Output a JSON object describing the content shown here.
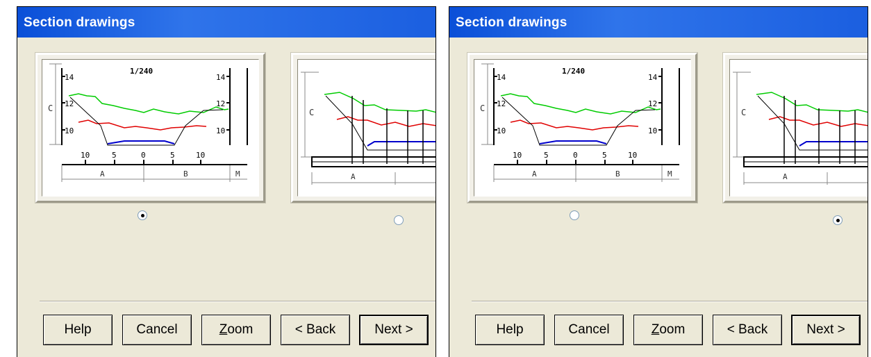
{
  "panels": [
    {
      "title": "Section drawings",
      "selected_option": 1,
      "buttons": {
        "help": "Help",
        "cancel": "Cancel",
        "zoom": "Zoom",
        "back": "< Back",
        "next": "Next >"
      }
    },
    {
      "title": "Section drawings",
      "selected_option": 2,
      "buttons": {
        "help": "Help",
        "cancel": "Cancel",
        "zoom": "Zoom",
        "back": "< Back",
        "next": "Next >"
      }
    }
  ],
  "drawing1": {
    "scale": "1/240",
    "left_ticks": [
      "14",
      "12",
      "10"
    ],
    "right_ticks": [
      "14",
      "12",
      "10"
    ],
    "bottom_ticks": [
      "10",
      "5",
      "0",
      "5",
      "10"
    ],
    "dim_labels": [
      "C",
      "A",
      "B",
      "M"
    ]
  },
  "drawing2": {
    "dim_labels": [
      "C",
      "A"
    ]
  },
  "colors": {
    "title_bar": "#1b5fe0",
    "surface_line": "#00cc00",
    "water_line": "#e00000",
    "bed_line": "#0000cc"
  }
}
